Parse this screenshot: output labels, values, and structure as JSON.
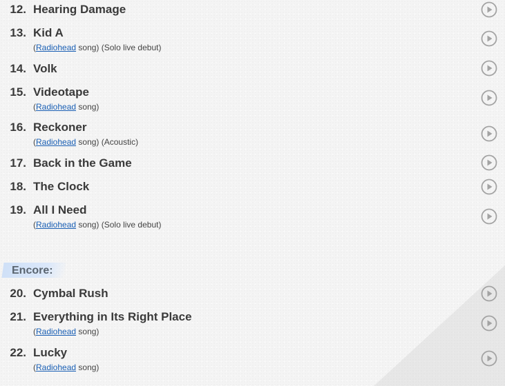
{
  "songs_main": [
    {
      "number": "12.",
      "title": "Hearing Damage",
      "has_info": false
    },
    {
      "number": "13.",
      "title": "Kid A",
      "has_info": true,
      "info_prefix": "(",
      "info_link": "Radiohead",
      "info_suffix": " song) (Solo live debut)"
    },
    {
      "number": "14.",
      "title": "Volk",
      "has_info": false
    },
    {
      "number": "15.",
      "title": "Videotape",
      "has_info": true,
      "info_prefix": "(",
      "info_link": "Radiohead",
      "info_suffix": " song)"
    },
    {
      "number": "16.",
      "title": "Reckoner",
      "has_info": true,
      "info_prefix": "(",
      "info_link": "Radiohead",
      "info_suffix": " song) (Acoustic)"
    },
    {
      "number": "17.",
      "title": "Back in the Game",
      "has_info": false
    },
    {
      "number": "18.",
      "title": "The Clock",
      "has_info": false
    },
    {
      "number": "19.",
      "title": "All I Need",
      "has_info": true,
      "info_prefix": "(",
      "info_link": "Radiohead",
      "info_suffix": " song) (Solo live debut)"
    }
  ],
  "encore": {
    "label": "Encore:"
  },
  "songs_encore": [
    {
      "number": "20.",
      "title": "Cymbal Rush",
      "has_info": false
    },
    {
      "number": "21.",
      "title": "Everything in Its Right Place",
      "has_info": true,
      "info_prefix": "(",
      "info_link": "Radiohead",
      "info_suffix": " song)"
    },
    {
      "number": "22.",
      "title": "Lucky",
      "has_info": true,
      "info_prefix": "(",
      "info_link": "Radiohead",
      "info_suffix": " song)"
    }
  ],
  "icons": {
    "play": "play-circle-icon"
  },
  "colors": {
    "link": "#1a5fb4",
    "encore_highlight": "#cfe0f7",
    "title": "#3a3a3a"
  }
}
